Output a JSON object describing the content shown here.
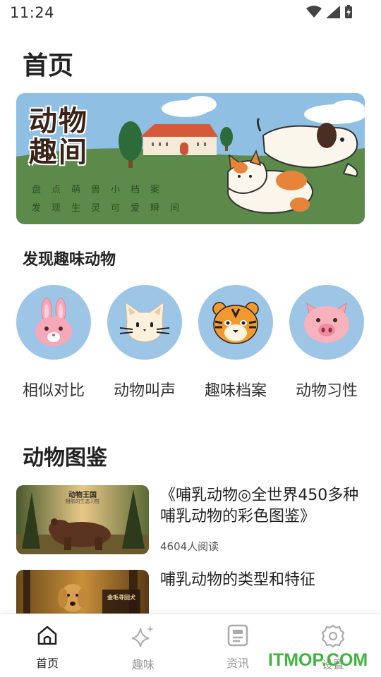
{
  "status_bar": {
    "time": "11:24"
  },
  "page_title": "首页",
  "banner": {
    "title_line1": "动物",
    "title_line2": "趣间",
    "subtitle_line1": "盘点萌兽小档案",
    "subtitle_line2": "发现生灵可爱瞬间"
  },
  "discover": {
    "title": "发现趣味动物",
    "categories": [
      {
        "label": "相似对比",
        "icon": "rabbit-icon"
      },
      {
        "label": "动物叫声",
        "icon": "cat-icon"
      },
      {
        "label": "趣味档案",
        "icon": "tiger-icon"
      },
      {
        "label": "动物习性",
        "icon": "pig-icon"
      }
    ]
  },
  "atlas": {
    "title": "动物图鉴",
    "articles": [
      {
        "title": "《哺乳动物◎全世界450多种哺乳动物的彩色图鉴》",
        "reads": "4604人阅读",
        "thumb_caption": "动物王国",
        "thumb_sub": "相依的生态习性"
      },
      {
        "title": "哺乳动物的类型和特征",
        "reads": "",
        "thumb_caption": "金毛寻回犬"
      }
    ]
  },
  "tabbar": {
    "tabs": [
      {
        "label": "首页",
        "icon": "home-icon",
        "active": true
      },
      {
        "label": "趣味",
        "icon": "sparkle-icon",
        "active": false
      },
      {
        "label": "资讯",
        "icon": "news-icon",
        "active": false
      },
      {
        "label": "设置",
        "icon": "gear-icon",
        "active": false
      }
    ]
  },
  "watermark": "ITMOP.COM",
  "colors": {
    "accent_blue": "#9dc5e6",
    "banner_green": "#5b8a4a",
    "sky_blue": "#8fc0e4",
    "watermark_green": "#3fb53f"
  }
}
